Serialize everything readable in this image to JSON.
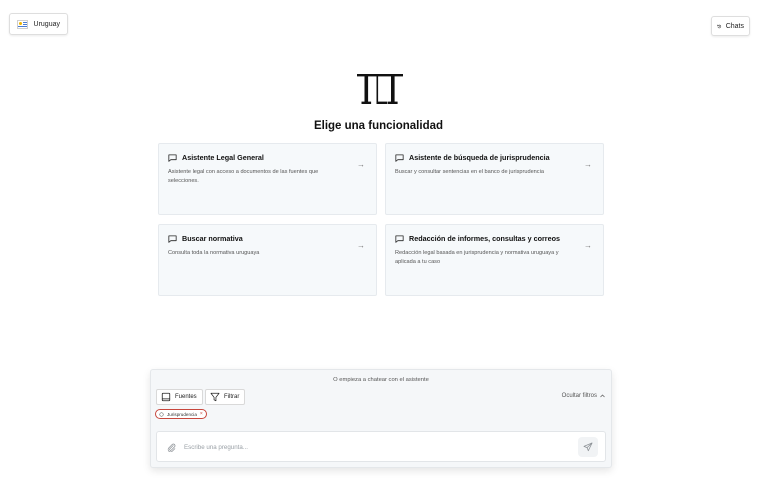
{
  "header": {
    "country_label": "Uruguay",
    "chats_label": "Chats",
    "icons": {
      "country": "uruguay-flag-icon",
      "chats": "history-icon"
    }
  },
  "brand": {
    "logo": "TLT",
    "headline": "Elige una funcionalidad"
  },
  "cards": [
    {
      "title": "Asistente Legal General",
      "description": "Asistente legal con acceso a documentos de las fuentes que selecciones.",
      "icon": "chat-bubble-icon"
    },
    {
      "title": "Asistente de búsqueda de jurisprudencia",
      "description": "Buscar y consultar sentencias en el banco de jurisprudencia",
      "icon": "chat-bubble-icon"
    },
    {
      "title": "Buscar normativa",
      "description": "Consulta toda la normativa uruguaya",
      "icon": "chat-bubble-icon"
    },
    {
      "title": "Redacción de informes, consultas y correos",
      "description": "Redacción legal basada en jurisprudencia y normativa uruguaya y aplicada a tu caso",
      "icon": "chat-bubble-icon"
    }
  ],
  "chat": {
    "prompt": "O empieza a chatear con el asistente",
    "sources_label": "Fuentes",
    "filter_label": "Filtrar",
    "hide_filters_label": "Ocultar filtros",
    "tag_label": "Jurisprudencia",
    "input_placeholder": "Escribe una pregunta...",
    "input_value": ""
  },
  "colors": {
    "accent_tag": "#c8473d",
    "card_bg": "#f6f9fb",
    "flag_blue": "#4a7bd0",
    "flag_sun": "#f0b400"
  }
}
